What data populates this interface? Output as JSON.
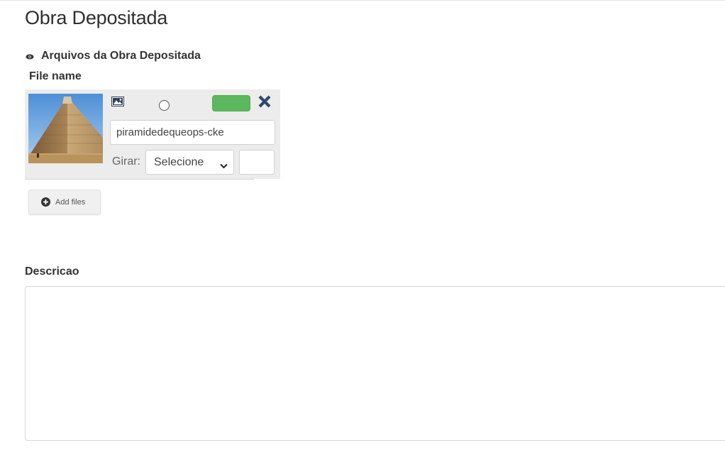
{
  "page": {
    "title": "Obra Depositada"
  },
  "section": {
    "title": "Arquivos da Obra Depositada",
    "icon": "eye-icon"
  },
  "files": {
    "column_label": "File name",
    "item": {
      "name_value": "piramidedequeops-cke",
      "thumbnail_icon": "image-icon",
      "rotate_label": "Girar:",
      "rotate_selected": "Selecione",
      "rotate_extra_value": "",
      "remove_icon": "close-icon",
      "confirm_color": "#5cb85c"
    },
    "add_button_label": "Add files",
    "add_button_icon": "plus-circle-icon"
  },
  "description": {
    "label": "Descricao",
    "value": ""
  }
}
